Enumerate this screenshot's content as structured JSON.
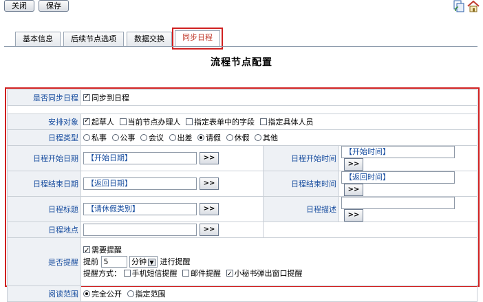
{
  "toolbar": {
    "close_label": "关闭",
    "save_label": "保存"
  },
  "tabs": [
    {
      "label": "基本信息",
      "active": false
    },
    {
      "label": "后续节点选项",
      "active": false
    },
    {
      "label": "数据交换",
      "active": false
    },
    {
      "label": "同步日程",
      "active": true
    }
  ],
  "page_title": "流程节点配置",
  "form": {
    "sync": {
      "label": "是否同步日程",
      "option": "同步到日程",
      "checked": true
    },
    "arrange": {
      "label": "安排对象",
      "options": [
        {
          "text": "起草人",
          "checked": true
        },
        {
          "text": "当前节点办理人",
          "checked": false
        },
        {
          "text": "指定表单中的字段",
          "checked": false
        },
        {
          "text": "指定具体人员",
          "checked": false
        }
      ]
    },
    "type": {
      "label": "日程类型",
      "options": [
        {
          "text": "私事",
          "checked": false
        },
        {
          "text": "公事",
          "checked": false
        },
        {
          "text": "会议",
          "checked": false
        },
        {
          "text": "出差",
          "checked": false
        },
        {
          "text": "请假",
          "checked": true
        },
        {
          "text": "休假",
          "checked": false
        },
        {
          "text": "其他",
          "checked": false
        }
      ]
    },
    "start_date": {
      "label": "日程开始日期",
      "value": "【开始日期】"
    },
    "start_time": {
      "label": "日程开始时间",
      "value": "【开始时间】"
    },
    "end_date": {
      "label": "日程结束日期",
      "value": "【返回日期】"
    },
    "end_time": {
      "label": "日程结束时间",
      "value": "【返回时间】"
    },
    "title": {
      "label": "日程标题",
      "value": "【请休假类别】"
    },
    "desc": {
      "label": "日程描述",
      "value": ""
    },
    "place": {
      "label": "日程地点",
      "value": ""
    },
    "picker_label": ">>",
    "remind": {
      "label": "是否提醒",
      "need_label": "需要提醒",
      "need_checked": true,
      "advance_label": "提前",
      "advance_value": "5",
      "unit": "分钟",
      "suffix": "进行提醒",
      "method_label": "提醒方式：",
      "methods": [
        {
          "text": "手机短信提醒",
          "checked": false
        },
        {
          "text": "邮件提醒",
          "checked": false
        },
        {
          "text": "小秘书弹出窗口提醒",
          "checked": true
        }
      ]
    },
    "read_scope": {
      "label": "阅读范围",
      "options": [
        {
          "text": "完全公开",
          "checked": true
        },
        {
          "text": "指定范围",
          "checked": false
        }
      ]
    }
  },
  "icons": [
    "copy-icon",
    "home-icon"
  ]
}
